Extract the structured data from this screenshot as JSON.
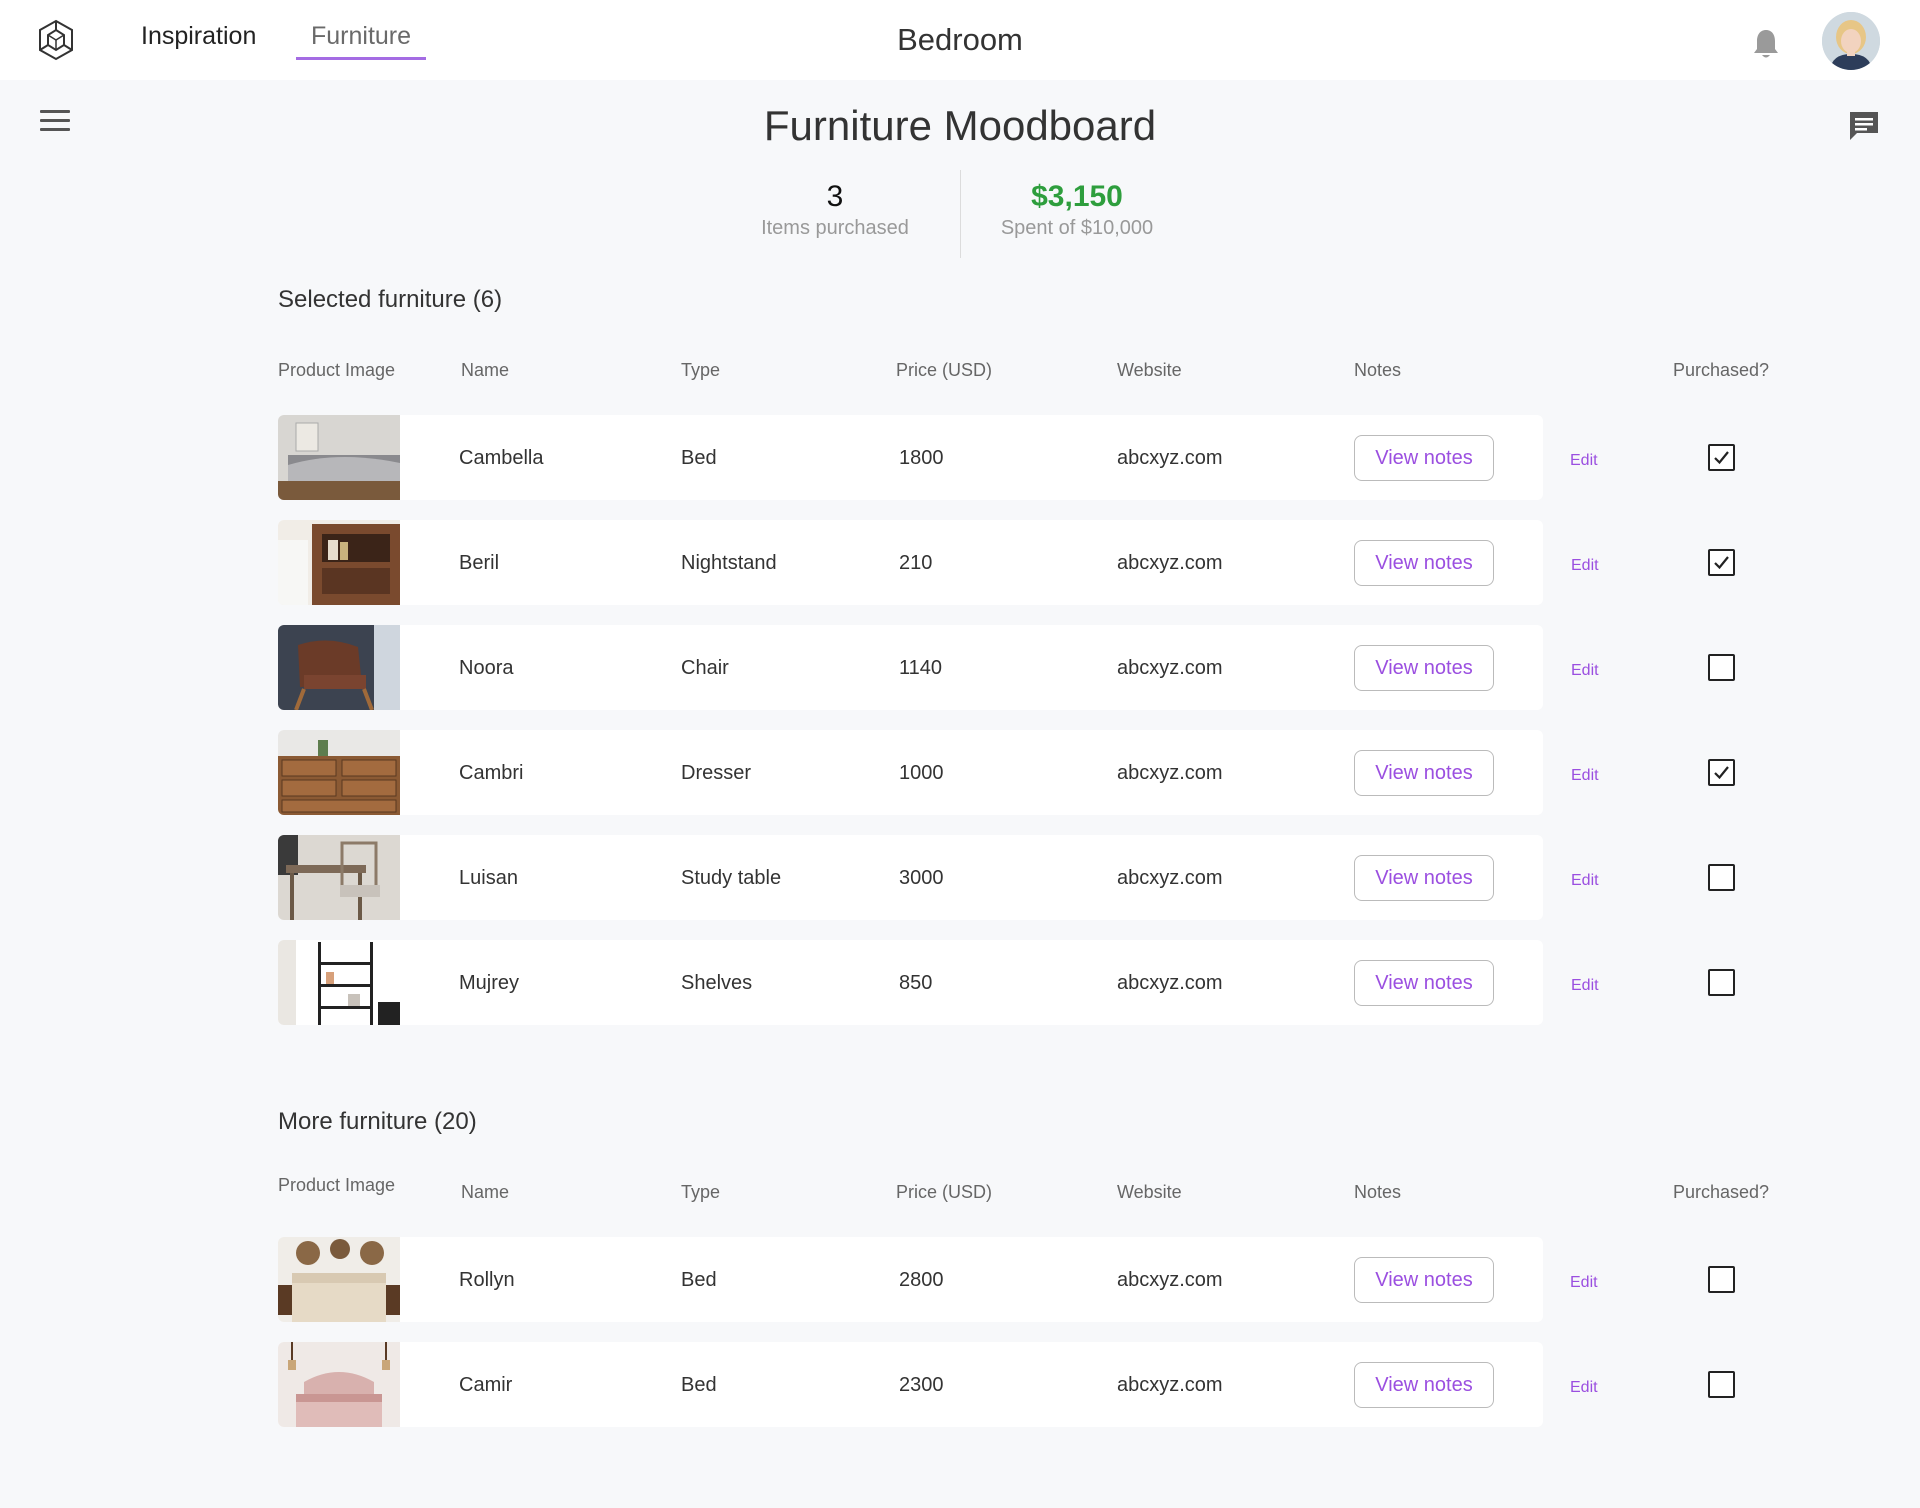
{
  "nav": {
    "inspiration": "Inspiration",
    "furniture": "Furniture"
  },
  "room_title": "Bedroom",
  "page_title": "Furniture Moodboard",
  "stats": {
    "items_count": "3",
    "items_label": "Items purchased",
    "spent_amount": "$3,150",
    "spent_label": "Spent of $10,000"
  },
  "columns": {
    "image": "Product Image",
    "name": "Name",
    "type": "Type",
    "price": "Price (USD)",
    "website": "Website",
    "notes": "Notes",
    "purchased": "Purchased?"
  },
  "selected": {
    "title": "Selected furniture (6)",
    "rows": [
      {
        "name": "Cambella",
        "type": "Bed",
        "price": "1800",
        "website": "abcxyz.com",
        "notes": "View notes",
        "edit": "Edit",
        "purchased": true
      },
      {
        "name": "Beril",
        "type": "Nightstand",
        "price": "210",
        "website": "abcxyz.com",
        "notes": "View notes",
        "edit": "Edit",
        "purchased": true
      },
      {
        "name": "Noora",
        "type": "Chair",
        "price": "1140",
        "website": "abcxyz.com",
        "notes": "View notes",
        "edit": "Edit",
        "purchased": false
      },
      {
        "name": "Cambri",
        "type": "Dresser",
        "price": "1000",
        "website": "abcxyz.com",
        "notes": "View notes",
        "edit": "Edit",
        "purchased": true
      },
      {
        "name": "Luisan",
        "type": "Study table",
        "price": "3000",
        "website": "abcxyz.com",
        "notes": "View notes",
        "edit": "Edit",
        "purchased": false
      },
      {
        "name": "Mujrey",
        "type": "Shelves",
        "price": "850",
        "website": "abcxyz.com",
        "notes": "View notes",
        "edit": "Edit",
        "purchased": false
      }
    ]
  },
  "more": {
    "title": "More furniture (20)",
    "rows": [
      {
        "name": "Rollyn",
        "type": "Bed",
        "price": "2800",
        "website": "abcxyz.com",
        "notes": "View notes",
        "edit": "Edit",
        "purchased": false
      },
      {
        "name": "Camir",
        "type": "Bed",
        "price": "2300",
        "website": "abcxyz.com",
        "notes": "View notes",
        "edit": "Edit",
        "purchased": false
      }
    ]
  },
  "colors": {
    "accent": "#9b4fe0",
    "tab_underline": "#a46ce3",
    "spent_green": "#2e9e3d",
    "background": "#f7f8fa"
  },
  "icons": {
    "logo": "hexagon-cube-icon",
    "notifications": "bell-icon",
    "menu": "hamburger-menu-icon",
    "comments": "chat-bubble-icon",
    "check": "checkmark-icon"
  }
}
